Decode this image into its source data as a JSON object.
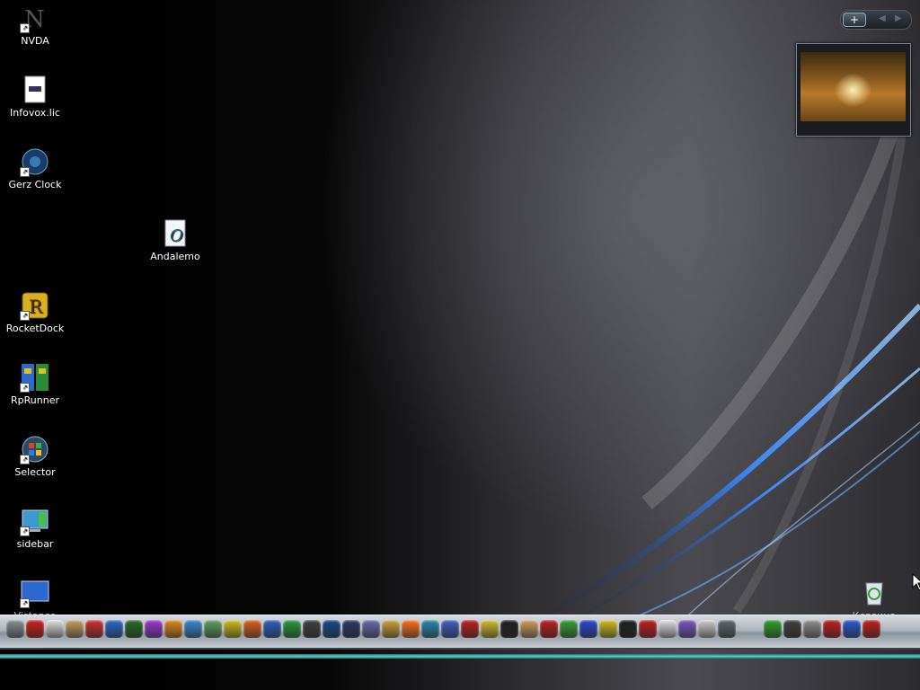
{
  "desktop": {
    "icons": [
      {
        "label": "NVDA",
        "icon": "nvda-icon",
        "shortcut": true
      },
      {
        "label": "Infovox.lic",
        "icon": "document-icon",
        "shortcut": false
      },
      {
        "label": "Gerz Clock",
        "icon": "clock-icon",
        "shortcut": true
      },
      {
        "label": "Andalemo",
        "icon": "font-file-icon",
        "shortcut": false
      },
      {
        "label": "RocketDock",
        "icon": "rocketdock-icon",
        "shortcut": true
      },
      {
        "label": "RpRunner",
        "icon": "rprunner-icon",
        "shortcut": true
      },
      {
        "label": "Selector",
        "icon": "windows-orb-icon",
        "shortcut": true
      },
      {
        "label": "sidebar",
        "icon": "sidebar-icon",
        "shortcut": true
      },
      {
        "label": "Vistance",
        "icon": "monitor-icon",
        "shortcut": true
      },
      {
        "label": "Корзина",
        "icon": "recycle-bin-icon",
        "shortcut": false
      }
    ]
  },
  "sidebar_widget": {
    "add_label": "+",
    "prev_label": "◀",
    "next_label": "▶"
  },
  "dock": {
    "icon_colors": [
      "#8a9098",
      "#d02020",
      "#e0e0e0",
      "#c8a060",
      "#d03030",
      "#2a6ad0",
      "#2a6a2a",
      "#9a3ad0",
      "#e08a20",
      "#3a8ad0",
      "#60a060",
      "#d0c020",
      "#e06020",
      "#3060c0",
      "#2a9a3a",
      "#404040",
      "#1a4a8a",
      "#2a3a6a",
      "#6a6ab0",
      "#d0a040",
      "#ff7020",
      "#2a8ab0",
      "#4060c0",
      "#c02020",
      "#d0c030",
      "#202020",
      "#d0a060",
      "#c02020",
      "#3aa03a",
      "#2a4ad0",
      "#d0c020",
      "#202020",
      "#c02020",
      "#e0e0e0",
      "#7a5ac0",
      "#d0d0d0",
      "#606870",
      "#30a030",
      "#404040",
      "#909090",
      "#c02020",
      "#2a5ad0",
      "#c02020"
    ]
  }
}
